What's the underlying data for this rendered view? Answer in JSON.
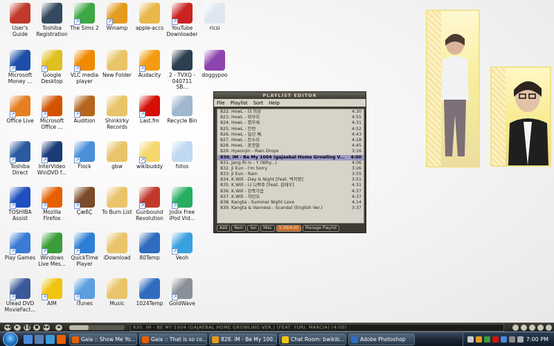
{
  "desktop": {
    "icons": [
      {
        "label": "User's Guide",
        "icon": "compass-icon",
        "color": "#c0392b",
        "shortcut": false
      },
      {
        "label": "Toshiba Registration",
        "icon": "laptop-icon",
        "color": "#34495e",
        "shortcut": false
      },
      {
        "label": "The Sims 2",
        "icon": "sims-plumbob-icon",
        "color": "#3ea845",
        "shortcut": true
      },
      {
        "label": "Winamp",
        "icon": "winamp-icon",
        "color": "#e49b1e",
        "shortcut": true
      },
      {
        "label": "apple-accs",
        "icon": "zip-folder-icon",
        "color": "#e8b84b",
        "shortcut": false
      },
      {
        "label": "YouTube Downloader",
        "icon": "youtube-downloader-icon",
        "color": "#cc2222",
        "shortcut": true
      },
      {
        "label": "ricsi",
        "icon": "document-icon",
        "color": "#dfe6f0",
        "shortcut": false
      },
      {
        "label": "Microsoft Money ...",
        "icon": "money-icon",
        "color": "#1e4fa8",
        "shortcut": true
      },
      {
        "label": "Google Desktop",
        "icon": "google-desktop-icon",
        "color": "#e0c020",
        "shortcut": true
      },
      {
        "label": "VLC media player",
        "icon": "vlc-cone-icon",
        "color": "#f08a00",
        "shortcut": true
      },
      {
        "label": "New Folder",
        "icon": "folder-icon",
        "color": "#e9c46a",
        "shortcut": false
      },
      {
        "label": "Audacity",
        "icon": "audacity-icon",
        "color": "#f39c12",
        "shortcut": true
      },
      {
        "label": "2 - TVXQ - 040711 SB...",
        "icon": "video-file-icon",
        "color": "#2c3e50",
        "shortcut": false
      },
      {
        "label": "doggypoo",
        "icon": "winrar-archive-icon",
        "color": "#8e44ad",
        "shortcut": false
      },
      {
        "label": "Office Live",
        "icon": "office-live-icon",
        "color": "#e67e22",
        "shortcut": true
      },
      {
        "label": "Microsoft Office ...",
        "icon": "office-icon",
        "color": "#d35400",
        "shortcut": true
      },
      {
        "label": "Audition",
        "icon": "audition-avatar-icon",
        "color": "#b5651d",
        "shortcut": true
      },
      {
        "label": "Shinkirky Records",
        "icon": "folder-icon",
        "color": "#e9c46a",
        "shortcut": false
      },
      {
        "label": "Last.fm",
        "icon": "lastfm-icon",
        "color": "#d51007",
        "shortcut": true
      },
      {
        "label": "Recycle Bin",
        "icon": "recycle-bin-icon",
        "color": "#9fb7cf",
        "shortcut": false
      },
      {
        "label": "Toshiba Direct",
        "icon": "toshiba-direct-icon",
        "color": "#2c5aa0",
        "shortcut": true
      },
      {
        "label": "InterVideo WinDVD f...",
        "icon": "windvd-icon",
        "color": "#1a3c78",
        "shortcut": true
      },
      {
        "label": "Flock",
        "icon": "flock-icon",
        "color": "#4a90d9",
        "shortcut": true
      },
      {
        "label": "gbw",
        "icon": "folder-icon",
        "color": "#e9c46a",
        "shortcut": false
      },
      {
        "label": "wikibuddy",
        "icon": "wikibuddy-icon",
        "color": "#f5d76e",
        "shortcut": true
      },
      {
        "label": "fotos",
        "icon": "text-file-icon",
        "color": "#c0d8f0",
        "shortcut": false
      },
      {
        "label": "TOSHIBA Assist",
        "icon": "toshiba-assist-icon",
        "color": "#1f4fbf",
        "shortcut": true
      },
      {
        "label": "Mozilla Firefox",
        "icon": "firefox-icon",
        "color": "#e66000",
        "shortcut": true
      },
      {
        "label": "ÇæßÇ",
        "icon": "audition-avatar-icon",
        "color": "#7b4a2a",
        "shortcut": true
      },
      {
        "label": "To Burn List",
        "icon": "folder-icon",
        "color": "#e9c46a",
        "shortcut": false
      },
      {
        "label": "Gunbound Revolution",
        "icon": "gunbound-icon",
        "color": "#c0392b",
        "shortcut": true
      },
      {
        "label": "Jodix Free iPod Vid...",
        "icon": "ipod-video-icon",
        "color": "#27ae60",
        "shortcut": true
      },
      {
        "label": "Play Games",
        "icon": "games-icon",
        "color": "#3a7bd5",
        "shortcut": true
      },
      {
        "label": "Windows Live Mes...",
        "icon": "messenger-icon",
        "color": "#3a9d3a",
        "shortcut": true
      },
      {
        "label": "QuickTime Player",
        "icon": "quicktime-icon",
        "color": "#2d7fd3",
        "shortcut": true
      },
      {
        "label": "iDownload",
        "icon": "folder-icon",
        "color": "#e9c46a",
        "shortcut": false
      },
      {
        "label": "80Temp",
        "icon": "psd-file-icon",
        "color": "#2f6cbf",
        "shortcut": false
      },
      {
        "label": "Veoh",
        "icon": "veoh-icon",
        "color": "#3aa0e0",
        "shortcut": true
      },
      {
        "label": "Ulead DVD MovieFact...",
        "icon": "ulead-dvd-icon",
        "color": "#3b5998",
        "shortcut": true
      },
      {
        "label": "AIM",
        "icon": "aim-running-man-icon",
        "color": "#f1c40f",
        "shortcut": true
      },
      {
        "label": "iTunes",
        "icon": "itunes-icon",
        "color": "#5c9ee0",
        "shortcut": true
      },
      {
        "label": "Music",
        "icon": "folder-icon",
        "color": "#e9c46a",
        "shortcut": false
      },
      {
        "label": "1024Temp",
        "icon": "psd-file-icon",
        "color": "#2f6cbf",
        "shortcut": false
      },
      {
        "label": "GoldWave",
        "icon": "goldwave-icon",
        "color": "#8a8f98",
        "shortcut": true
      }
    ]
  },
  "playlist": {
    "title": "PLAYLIST EDITOR",
    "menu": [
      "File",
      "Playlist",
      "Sort",
      "Help"
    ],
    "rows": [
      {
        "title": "822. HowL - 더 미상",
        "time": "4:30"
      },
      {
        "title": "823. HowL - 마무리",
        "time": "4:55"
      },
      {
        "title": "824. HowL - 염무새",
        "time": "4:31"
      },
      {
        "title": "825. HowL - 인연",
        "time": "4:52"
      },
      {
        "title": "826. HowL - 일년 째",
        "time": "4:43"
      },
      {
        "title": "827. HowL - 잔소리",
        "time": "4:18"
      },
      {
        "title": "828. HowL - 혼잣말",
        "time": "4:45"
      },
      {
        "title": "829. Hyeonjin - Rain Drops",
        "time": "3:16"
      },
      {
        "title": "830. iM - Be My 1004 (gajaebal Home Growling Ver.) (feat. ...",
        "time": "4:00"
      },
      {
        "title": "831. Jang Ri in - Y (Why...)",
        "time": "4:06"
      },
      {
        "title": "832. Ji Eun - I'm Sorry",
        "time": "3:26"
      },
      {
        "title": "833. Ji Eun - Rain",
        "time": "3:55"
      },
      {
        "title": "834. K.Will - Day & Night [Feat. 벅지영]",
        "time": "3:51"
      },
      {
        "title": "835. K.Will - 나 나쁘죠 [Feat. 김태우]",
        "time": "4:31"
      },
      {
        "title": "836. K.Will - 된죽가슴",
        "time": "4:37"
      },
      {
        "title": "837. K.Will - 하던오",
        "time": "4:37"
      },
      {
        "title": "838. Kangta - Summer Night Love",
        "time": "4:14"
      },
      {
        "title": "839. Kangta & Vanness - Scandal (English Ver.)",
        "time": "3:37"
      }
    ],
    "active_index": 8,
    "buttons": [
      "Add",
      "Rem",
      "Sel",
      "Misc",
      "5:28/4:00",
      "Manage Playlist"
    ]
  },
  "winamp_bar": {
    "ticker": "830. iM - BE MY 1004 (GAJAEBAL HOME GROWLING VER.) (FEAT. YURI, MARCIA) (4:00)",
    "controls": [
      "prev",
      "play",
      "pause",
      "stop",
      "next"
    ],
    "seek_fraction": 0.35
  },
  "taskbar": {
    "tasks": [
      {
        "label": "Gaia :: Show Me Yo...",
        "icon": "firefox-icon",
        "color": "#e66000",
        "active": false
      },
      {
        "label": "Gaia :: That is so co...",
        "icon": "firefox-icon",
        "color": "#e66000",
        "active": false
      },
      {
        "label": "828. iM - Be My 100...",
        "icon": "winamp-icon",
        "color": "#e49b1e",
        "active": false
      },
      {
        "label": "Chat Room: bwikib...",
        "icon": "chat-icon",
        "color": "#f1c40f",
        "active": false
      },
      {
        "label": "Adobe Photoshop",
        "icon": "photoshop-icon",
        "color": "#2f6cbf",
        "active": false
      }
    ],
    "clock": "7:00 PM"
  }
}
